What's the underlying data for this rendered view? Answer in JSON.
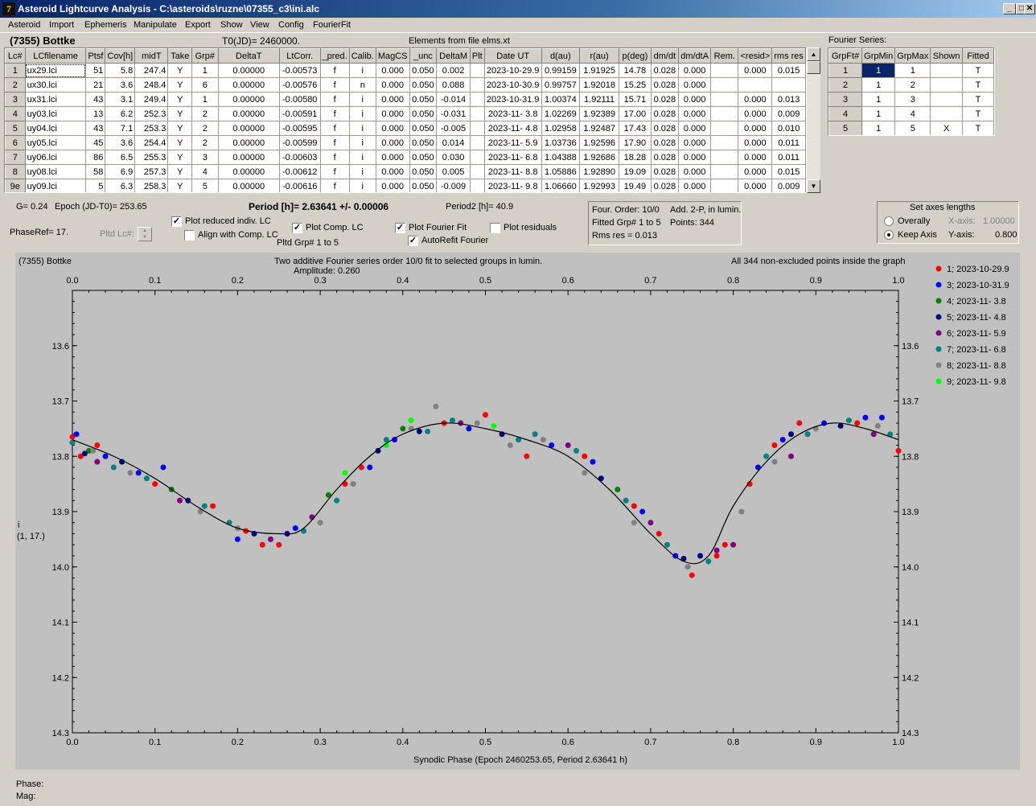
{
  "window": {
    "title": "Asteroid Lightcurve Analysis - C:\\asteroids\\ruzne\\07355_c3\\ini.alc",
    "icon": "7"
  },
  "menu": [
    "Asteroid",
    "Import",
    "Ephemeris",
    "Manipulate",
    "Export",
    "Show",
    "View",
    "Config",
    "FourierFit"
  ],
  "header": {
    "asteroid": "(7355) Bottke",
    "t0": "T0(JD)= 2460000.",
    "elements": "Elements from file elms.xt",
    "fourier_label": "Fourier Series:"
  },
  "lc_table": {
    "columns": [
      "Lc#",
      "LCfilename",
      "Ptsf",
      "Cov[h]",
      "midT",
      "Take",
      "Grp#",
      "DeltaT",
      "LtCorr.",
      "_pred.",
      "Calib.",
      "MagCS",
      "_unc",
      "DeltaM",
      "Plt",
      "Date UT",
      "d(au)",
      "r(au)",
      "p(deg)",
      "dm/dt",
      "dm/dtA",
      "Rem.",
      "<resid>",
      "rms res"
    ],
    "rows": [
      [
        "1",
        "ux29.lci",
        "51",
        "5.8",
        "247.4",
        "Y",
        "1",
        "0.00000",
        "-0.00573",
        "f",
        "i",
        "0.000",
        "0.050",
        "0.002",
        "",
        "2023-10-29.9",
        "0.99159",
        "1.91925",
        "14.78",
        "0.028",
        "0.000",
        "",
        "0.000",
        "0.015"
      ],
      [
        "2",
        "ux30.lci",
        "21",
        "3.6",
        "248.4",
        "Y",
        "6",
        "0.00000",
        "-0.00576",
        "f",
        "n",
        "0.000",
        "0.050",
        "0.088",
        "",
        "2023-10-30.9",
        "0.99757",
        "1.92018",
        "15.25",
        "0.028",
        "0.000",
        "",
        "",
        ""
      ],
      [
        "3",
        "ux31.lci",
        "43",
        "3.1",
        "249.4",
        "Y",
        "1",
        "0.00000",
        "-0.00580",
        "f",
        "i",
        "0.000",
        "0.050",
        "-0.014",
        "",
        "2023-10-31.9",
        "1.00374",
        "1.92111",
        "15.71",
        "0.028",
        "0.000",
        "",
        "0.000",
        "0.013"
      ],
      [
        "4",
        "uy03.lci",
        "13",
        "6.2",
        "252.3",
        "Y",
        "2",
        "0.00000",
        "-0.00591",
        "f",
        "i",
        "0.000",
        "0.050",
        "-0.031",
        "",
        "2023-11- 3.8",
        "1.02269",
        "1.92389",
        "17.00",
        "0.028",
        "0.000",
        "",
        "0.000",
        "0.009"
      ],
      [
        "5",
        "uy04.lci",
        "43",
        "7.1",
        "253.3",
        "Y",
        "2",
        "0.00000",
        "-0.00595",
        "f",
        "i",
        "0.000",
        "0.050",
        "-0.005",
        "",
        "2023-11- 4.8",
        "1.02958",
        "1.92487",
        "17.43",
        "0.028",
        "0.000",
        "",
        "0.000",
        "0.010"
      ],
      [
        "6",
        "uy05.lci",
        "45",
        "3.6",
        "254.4",
        "Y",
        "2",
        "0.00000",
        "-0.00599",
        "f",
        "i",
        "0.000",
        "0.050",
        "0.014",
        "",
        "2023-11- 5.9",
        "1.03736",
        "1.92596",
        "17.90",
        "0.028",
        "0.000",
        "",
        "0.000",
        "0.011"
      ],
      [
        "7",
        "uy06.lci",
        "86",
        "6.5",
        "255.3",
        "Y",
        "3",
        "0.00000",
        "-0.00603",
        "f",
        "i",
        "0.000",
        "0.050",
        "0.030",
        "",
        "2023-11- 6.8",
        "1.04388",
        "1.92686",
        "18.28",
        "0.028",
        "0.000",
        "",
        "0.000",
        "0.011"
      ],
      [
        "8",
        "uy08.lci",
        "58",
        "6.9",
        "257.3",
        "Y",
        "4",
        "0.00000",
        "-0.00612",
        "f",
        "i",
        "0.000",
        "0.050",
        "0.005",
        "",
        "2023-11- 8.8",
        "1.05886",
        "1.92890",
        "19.09",
        "0.028",
        "0.000",
        "",
        "0.000",
        "0.015"
      ],
      [
        "9e",
        "uy09.lci",
        "5",
        "6.3",
        "258.3",
        "Y",
        "5",
        "0.00000",
        "-0.00616",
        "f",
        "i",
        "0.000",
        "0.050",
        "-0.009",
        "",
        "2023-11- 9.8",
        "1.06660",
        "1.92993",
        "19.49",
        "0.028",
        "0.000",
        "",
        "0.000",
        "0.009"
      ]
    ]
  },
  "fourier_table": {
    "columns": [
      "GrpFt#",
      "GrpMin",
      "GrpMax",
      "Shown",
      "Fitted"
    ],
    "rows": [
      [
        "1",
        "1",
        "1",
        "",
        "T"
      ],
      [
        "2",
        "1",
        "2",
        "",
        "T"
      ],
      [
        "3",
        "1",
        "3",
        "",
        "T"
      ],
      [
        "4",
        "1",
        "4",
        "",
        "T"
      ],
      [
        "5",
        "1",
        "5",
        "X",
        "T"
      ]
    ]
  },
  "controls": {
    "g": "G= 0.24",
    "epoch": "Epoch (JD-T0)= 253.65",
    "period": "Period [h]= 2.63641 +/- 0.00006",
    "period2": "Period2 [h]= 40.9",
    "phaseref": "PhaseRef= 17.",
    "pltd_lc": "Pltd Lc#:",
    "plot_reduced": "Plot reduced indiv. LC",
    "align": "Align with Comp. LC",
    "plot_comp": "Plot Comp. LC",
    "pltd_grp": "Pltd Grp#  1   to   5",
    "plot_fourier": "Plot Fourier Fit",
    "autorefit": "AutoRefit Fourier",
    "plot_resid": "Plot residuals",
    "info": [
      "Four. Order: 10/0",
      "Add. 2-P, in lumin.",
      "Fitted Grp# 1 to 5",
      "Points: 344",
      "Rms res      = 0.013"
    ],
    "axes": {
      "title": "Set axes lengths",
      "overall": "Overally",
      "keep": "Keep Axis",
      "xaxis": "X-axis:",
      "xval": "1.00000",
      "yaxis": "Y-axis:",
      "yval": "0.800"
    }
  },
  "plot": {
    "name": "(7355) Bottke",
    "caption": "Two additive Fourier series order 10/0 fit to selected groups in lumin.",
    "amplitude": "Amplitude: 0.260",
    "pointsnote": "All 344 non-excluded points inside the graph",
    "ylabel_band": "i",
    "ylabel_sub": "(1, 17.)",
    "xlabel": "Synodic Phase (Epoch 2460253.65, Period 2.63641 h)",
    "phase": "Phase:",
    "mag": "Mag:"
  },
  "chart_data": {
    "type": "scatter",
    "xlim": [
      0,
      1
    ],
    "ylim": [
      14.3,
      13.5
    ],
    "xticks": [
      "0.0",
      "0.1",
      "0.2",
      "0.3",
      "0.4",
      "0.5",
      "0.6",
      "0.7",
      "0.8",
      "0.9",
      "1.0"
    ],
    "yticks": [
      "13.6",
      "13.7",
      "13.8",
      "13.9",
      "14.0",
      "14.1",
      "14.2",
      "14.3"
    ],
    "legend": [
      {
        "name": "1; 2023-10-29.9",
        "color": "#ff0000"
      },
      {
        "name": "3; 2023-10-31.9",
        "color": "#0000ff"
      },
      {
        "name": "4; 2023-11- 3.8",
        "color": "#008000"
      },
      {
        "name": "5; 2023-11- 4.8",
        "color": "#00007f"
      },
      {
        "name": "6; 2023-11- 5.9",
        "color": "#800080"
      },
      {
        "name": "7; 2023-11- 6.8",
        "color": "#008080"
      },
      {
        "name": "8; 2023-11- 8.8",
        "color": "#808080"
      },
      {
        "name": "9; 2023-11- 9.8",
        "color": "#00ff00"
      }
    ],
    "fourier_curve": [
      [
        0.0,
        13.77
      ],
      [
        0.05,
        13.8
      ],
      [
        0.1,
        13.84
      ],
      [
        0.15,
        13.89
      ],
      [
        0.2,
        13.93
      ],
      [
        0.25,
        13.94
      ],
      [
        0.28,
        13.93
      ],
      [
        0.32,
        13.86
      ],
      [
        0.36,
        13.8
      ],
      [
        0.4,
        13.76
      ],
      [
        0.45,
        13.74
      ],
      [
        0.5,
        13.75
      ],
      [
        0.55,
        13.77
      ],
      [
        0.6,
        13.8
      ],
      [
        0.65,
        13.86
      ],
      [
        0.7,
        13.94
      ],
      [
        0.74,
        13.99
      ],
      [
        0.77,
        13.98
      ],
      [
        0.8,
        13.89
      ],
      [
        0.84,
        13.81
      ],
      [
        0.88,
        13.76
      ],
      [
        0.92,
        13.74
      ],
      [
        0.96,
        13.75
      ],
      [
        1.0,
        13.77
      ]
    ],
    "points": [
      [
        0.0,
        13.765,
        0
      ],
      [
        0.01,
        13.8,
        0
      ],
      [
        0.03,
        13.78,
        0
      ],
      [
        0.1,
        13.85,
        0
      ],
      [
        0.17,
        13.89,
        0
      ],
      [
        0.21,
        13.935,
        0
      ],
      [
        0.23,
        13.96,
        0
      ],
      [
        0.25,
        13.96,
        0
      ],
      [
        0.33,
        13.85,
        0
      ],
      [
        0.35,
        13.82,
        0
      ],
      [
        0.45,
        13.74,
        0
      ],
      [
        0.5,
        13.725,
        0
      ],
      [
        0.55,
        13.8,
        0
      ],
      [
        0.62,
        13.8,
        0
      ],
      [
        0.68,
        13.89,
        0
      ],
      [
        0.71,
        13.94,
        0
      ],
      [
        0.75,
        14.015,
        0
      ],
      [
        0.78,
        13.98,
        0
      ],
      [
        0.79,
        13.96,
        0
      ],
      [
        0.82,
        13.85,
        0
      ],
      [
        0.85,
        13.78,
        0
      ],
      [
        0.88,
        13.74,
        0
      ],
      [
        0.95,
        13.74,
        0
      ],
      [
        1.0,
        13.79,
        0
      ],
      [
        0.005,
        13.76,
        1
      ],
      [
        0.04,
        13.8,
        1
      ],
      [
        0.08,
        13.83,
        1
      ],
      [
        0.11,
        13.82,
        1
      ],
      [
        0.2,
        13.95,
        1
      ],
      [
        0.27,
        13.93,
        1
      ],
      [
        0.36,
        13.82,
        1
      ],
      [
        0.39,
        13.77,
        1
      ],
      [
        0.48,
        13.75,
        1
      ],
      [
        0.58,
        13.78,
        1
      ],
      [
        0.63,
        13.81,
        1
      ],
      [
        0.69,
        13.9,
        1
      ],
      [
        0.73,
        13.98,
        1
      ],
      [
        0.83,
        13.82,
        1
      ],
      [
        0.86,
        13.77,
        1
      ],
      [
        0.91,
        13.74,
        1
      ],
      [
        0.96,
        13.73,
        1
      ],
      [
        0.98,
        13.73,
        1
      ],
      [
        0.02,
        13.79,
        2
      ],
      [
        0.12,
        13.86,
        2
      ],
      [
        0.31,
        13.87,
        2
      ],
      [
        0.4,
        13.75,
        2
      ],
      [
        0.66,
        13.86,
        2
      ],
      [
        0.015,
        13.795,
        3
      ],
      [
        0.06,
        13.81,
        3
      ],
      [
        0.14,
        13.88,
        3
      ],
      [
        0.22,
        13.94,
        3
      ],
      [
        0.26,
        13.94,
        3
      ],
      [
        0.37,
        13.79,
        3
      ],
      [
        0.42,
        13.755,
        3
      ],
      [
        0.52,
        13.76,
        3
      ],
      [
        0.64,
        13.84,
        3
      ],
      [
        0.74,
        13.985,
        3
      ],
      [
        0.76,
        13.98,
        3
      ],
      [
        0.87,
        13.76,
        3
      ],
      [
        0.93,
        13.745,
        3
      ],
      [
        0.03,
        13.81,
        4
      ],
      [
        0.13,
        13.88,
        4
      ],
      [
        0.24,
        13.95,
        4
      ],
      [
        0.29,
        13.91,
        4
      ],
      [
        0.47,
        13.74,
        4
      ],
      [
        0.6,
        13.78,
        4
      ],
      [
        0.7,
        13.92,
        4
      ],
      [
        0.78,
        13.97,
        4
      ],
      [
        0.8,
        13.96,
        4
      ],
      [
        0.87,
        13.8,
        4
      ],
      [
        0.97,
        13.76,
        4
      ],
      [
        0.0,
        13.775,
        5
      ],
      [
        0.05,
        13.82,
        5
      ],
      [
        0.09,
        13.84,
        5
      ],
      [
        0.16,
        13.89,
        5
      ],
      [
        0.19,
        13.92,
        5
      ],
      [
        0.28,
        13.935,
        5
      ],
      [
        0.32,
        13.88,
        5
      ],
      [
        0.38,
        13.77,
        5
      ],
      [
        0.43,
        13.755,
        5
      ],
      [
        0.46,
        13.735,
        5
      ],
      [
        0.54,
        13.77,
        5
      ],
      [
        0.56,
        13.76,
        5
      ],
      [
        0.61,
        13.79,
        5
      ],
      [
        0.67,
        13.88,
        5
      ],
      [
        0.72,
        13.96,
        5
      ],
      [
        0.77,
        13.99,
        5
      ],
      [
        0.84,
        13.8,
        5
      ],
      [
        0.89,
        13.76,
        5
      ],
      [
        0.94,
        13.735,
        5
      ],
      [
        0.99,
        13.76,
        5
      ],
      [
        0.025,
        13.79,
        6
      ],
      [
        0.07,
        13.83,
        6
      ],
      [
        0.155,
        13.9,
        6
      ],
      [
        0.2,
        13.93,
        6
      ],
      [
        0.3,
        13.92,
        6
      ],
      [
        0.34,
        13.85,
        6
      ],
      [
        0.41,
        13.75,
        6
      ],
      [
        0.44,
        13.71,
        6
      ],
      [
        0.49,
        13.74,
        6
      ],
      [
        0.53,
        13.78,
        6
      ],
      [
        0.57,
        13.77,
        6
      ],
      [
        0.62,
        13.83,
        6
      ],
      [
        0.68,
        13.92,
        6
      ],
      [
        0.745,
        14.0,
        6
      ],
      [
        0.81,
        13.9,
        6
      ],
      [
        0.85,
        13.81,
        6
      ],
      [
        0.9,
        13.75,
        6
      ],
      [
        0.975,
        13.745,
        6
      ],
      [
        0.33,
        13.83,
        7
      ],
      [
        0.38,
        13.78,
        7
      ],
      [
        0.41,
        13.735,
        7
      ],
      [
        0.51,
        13.745,
        7
      ]
    ]
  }
}
